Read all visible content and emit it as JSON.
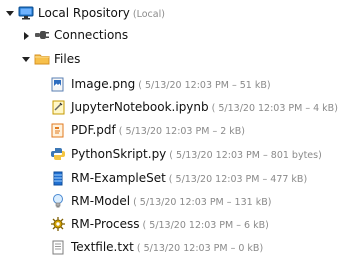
{
  "tree": {
    "root": {
      "label": "Local Rpository",
      "meta": "(Local)"
    },
    "connections": {
      "label": "Connections"
    },
    "files": {
      "label": "Files",
      "items": [
        {
          "label": "Image.png",
          "meta": "( 5/13/20 12:03 PM – 51 kB)"
        },
        {
          "label": "JupyterNotebook.ipynb",
          "meta": "( 5/13/20 12:03 PM – 4 kB)"
        },
        {
          "label": "PDF.pdf",
          "meta": "( 5/13/20 12:03 PM – 2 kB)"
        },
        {
          "label": "PythonSkript.py",
          "meta": "( 5/13/20 12:03 PM – 801 bytes)"
        },
        {
          "label": "RM-ExampleSet",
          "meta": "( 5/13/20 12:03 PM – 477 kB)"
        },
        {
          "label": "RM-Model",
          "meta": "( 5/13/20 12:03 PM – 131 kB)"
        },
        {
          "label": "RM-Process",
          "meta": "( 5/13/20 12:03 PM – 6 kB)"
        },
        {
          "label": "Textfile.txt",
          "meta": "( 5/13/20 12:03 PM – 0 kB)"
        }
      ]
    }
  },
  "icons": {
    "root": "computer-icon",
    "connections": "plug-icon",
    "files": "folder-icon"
  }
}
